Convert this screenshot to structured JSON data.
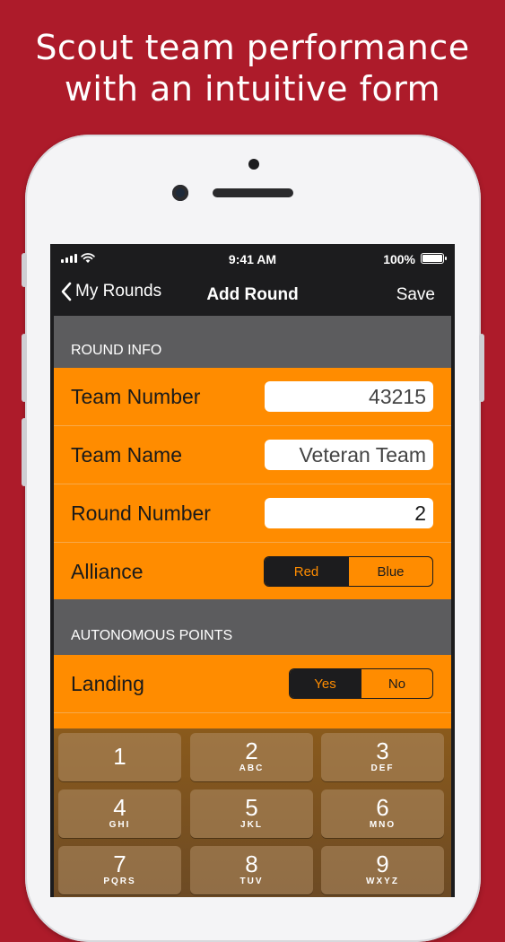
{
  "headline": {
    "line1": "Scout team performance",
    "line2": "with an intuitive form"
  },
  "status_bar": {
    "time": "9:41 AM",
    "battery": "100%",
    "battery_level": 1.0
  },
  "nav": {
    "back_label": "My Rounds",
    "title": "Add Round",
    "save_label": "Save"
  },
  "sections": {
    "round_info": {
      "header": "ROUND INFO",
      "team_number": {
        "label": "Team Number",
        "value": "43215"
      },
      "team_name": {
        "label": "Team Name",
        "value": "Veteran Team"
      },
      "round_number": {
        "label": "Round Number",
        "value": "2"
      },
      "alliance": {
        "label": "Alliance",
        "options": [
          "Red",
          "Blue"
        ],
        "selected": "Red"
      }
    },
    "autonomous": {
      "header": "AUTONOMOUS POINTS",
      "landing": {
        "label": "Landing",
        "options": [
          "Yes",
          "No"
        ],
        "selected": "Yes"
      }
    }
  },
  "keypad": {
    "keys": [
      {
        "num": "1",
        "letters": ""
      },
      {
        "num": "2",
        "letters": "ABC"
      },
      {
        "num": "3",
        "letters": "DEF"
      },
      {
        "num": "4",
        "letters": "GHI"
      },
      {
        "num": "5",
        "letters": "JKL"
      },
      {
        "num": "6",
        "letters": "MNO"
      },
      {
        "num": "7",
        "letters": "PQRS"
      },
      {
        "num": "8",
        "letters": "TUV"
      },
      {
        "num": "9",
        "letters": "WXYZ"
      }
    ]
  },
  "colors": {
    "background": "#ad1b2a",
    "form_orange": "#ff8c00",
    "section_gray": "#5c5c5e",
    "dark": "#1c1c1e"
  }
}
